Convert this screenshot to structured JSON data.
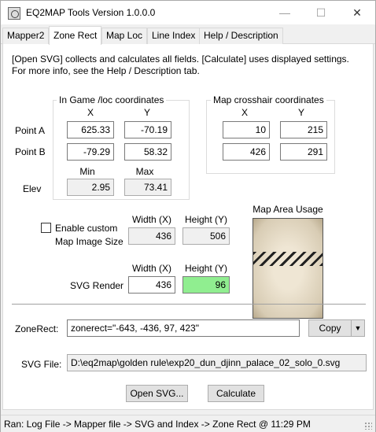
{
  "window": {
    "title": "EQ2MAP Tools Version 1.0.0.0",
    "minimize": "—",
    "maximize": "☐",
    "close": "✕"
  },
  "tabs": [
    {
      "label": "Mapper2",
      "active": false
    },
    {
      "label": "Zone Rect",
      "active": true
    },
    {
      "label": "Map Loc",
      "active": false
    },
    {
      "label": "Line Index",
      "active": false
    },
    {
      "label": "Help / Description",
      "active": false
    }
  ],
  "info": {
    "line1": "[Open SVG] collects and calculates all fields. [Calculate] uses displayed settings.",
    "line2": "For more info, see the Help / Description tab."
  },
  "ingame": {
    "title": "In Game /loc coordinates",
    "col_x": "X",
    "col_y": "Y",
    "point_a_label": "Point A",
    "point_b_label": "Point B",
    "point_a_x": "625.33",
    "point_a_y": "-70.19",
    "point_b_x": "-79.29",
    "point_b_y": "58.32",
    "min_label": "Min",
    "max_label": "Max",
    "elev_label": "Elev",
    "elev_min": "2.95",
    "elev_max": "73.41"
  },
  "crosshair": {
    "title": "Map crosshair coordinates",
    "col_x": "X",
    "col_y": "Y",
    "point_a_x": "10",
    "point_a_y": "215",
    "point_b_x": "426",
    "point_b_y": "291"
  },
  "map_image": {
    "checkbox_label_1": "Enable custom",
    "checkbox_label_2": "Map Image Size",
    "checked": false,
    "width_label": "Width (X)",
    "height_label": "Height (Y)",
    "width": "436",
    "height": "506"
  },
  "svg_render": {
    "label": "SVG Render",
    "width_label": "Width (X)",
    "height_label": "Height (Y)",
    "width": "436",
    "height": "96",
    "height_highlight": "#90ee90"
  },
  "map_area": {
    "label": "Map Area Usage",
    "usage_top_fraction": 0.335,
    "usage_height_fraction": 0.145
  },
  "zonerect": {
    "label": "ZoneRect:",
    "value": "zonerect=\"-643, -436, 97, 423\"",
    "copy_label": "Copy",
    "dropdown_glyph": "▼"
  },
  "svg_file": {
    "label": "SVG File:",
    "value": "D:\\eq2map\\golden rule\\exp20_dun_djinn_palace_02_solo_0.svg"
  },
  "buttons": {
    "open_svg": "Open SVG...",
    "calculate": "Calculate"
  },
  "status": {
    "text": "Ran: Log File -> Mapper file -> SVG and Index -> Zone Rect @ 11:29 PM"
  }
}
